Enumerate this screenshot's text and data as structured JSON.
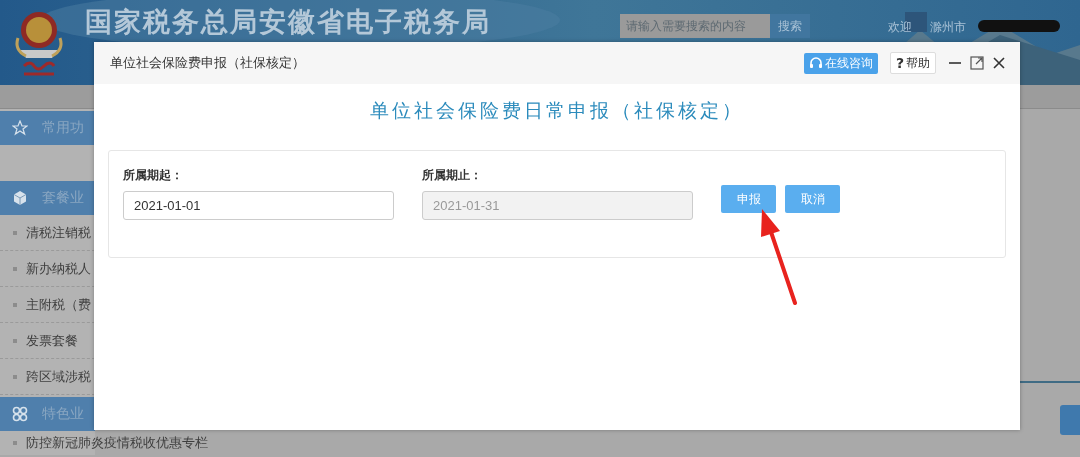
{
  "header": {
    "title": "国家税务总局安徽省电子税务局",
    "search": {
      "placeholder": "请输入需要搜索的内容",
      "button": "搜索"
    },
    "welcome": "欢迎",
    "user": "滁州市"
  },
  "sidebar": {
    "sections": [
      {
        "label": "常用功",
        "kind": "star"
      },
      {
        "label": "套餐业",
        "kind": "cube",
        "items": [
          "清税注销税",
          "新办纳税人",
          "主附税（费",
          "发票套餐",
          "跨区域涉税"
        ]
      },
      {
        "label": "特色业",
        "kind": "clover",
        "items": [
          "防控新冠肺炎疫情税收优惠专栏"
        ]
      }
    ]
  },
  "dialog": {
    "title": "单位社会保险费申报（社保核定）",
    "toolbar": [
      {
        "kind": "consult",
        "label": "在线咨询"
      },
      {
        "kind": "help",
        "icon": "?",
        "label": "帮助"
      }
    ],
    "heading": "单位社会保险费日常申报（社保核定）",
    "fields": [
      {
        "label": "所属期起：",
        "value": "2021-01-01",
        "disabled": false
      },
      {
        "label": "所属期止：",
        "value": "2021-01-31",
        "disabled": true
      }
    ],
    "buttons": [
      "申报",
      "取消"
    ]
  }
}
